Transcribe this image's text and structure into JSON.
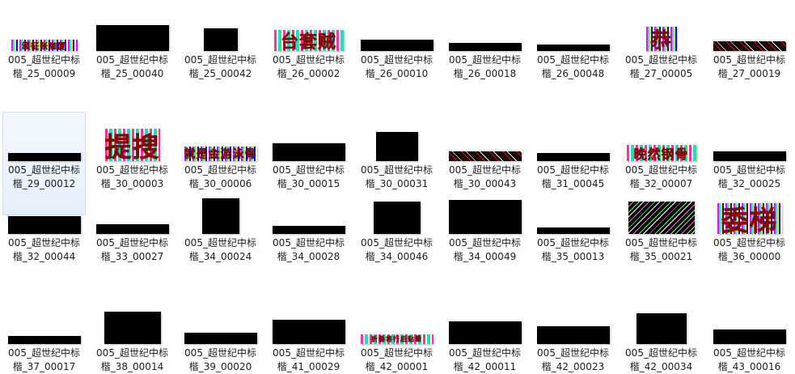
{
  "files": [
    {
      "line1": "005_超世纪中标",
      "line2": "楷_25_00009",
      "thumb": {
        "w": 82,
        "h": 14,
        "style": "stripe-a",
        "glyphs": "颂征张咖厦"
      },
      "selected": false
    },
    {
      "line1": "005_超世纪中标",
      "line2": "楷_25_00040",
      "thumb": {
        "w": 90,
        "h": 32,
        "style": "black"
      },
      "selected": false
    },
    {
      "line1": "005_超世纪中标",
      "line2": "楷_25_00042",
      "thumb": {
        "w": 42,
        "h": 28,
        "style": "black"
      },
      "selected": false
    },
    {
      "line1": "005_超世纪中标",
      "line2": "楷_26_00002",
      "thumb": {
        "w": 86,
        "h": 26,
        "style": "stripe-b",
        "glyphs": "台套贼"
      },
      "selected": false
    },
    {
      "line1": "005_超世纪中标",
      "line2": "楷_26_00010",
      "thumb": {
        "w": 90,
        "h": 14,
        "style": "black"
      },
      "selected": false
    },
    {
      "line1": "005_超世纪中标",
      "line2": "楷_26_00018",
      "thumb": {
        "w": 90,
        "h": 10,
        "style": "black"
      },
      "selected": false
    },
    {
      "line1": "005_超世纪中标",
      "line2": "楷_26_00048",
      "thumb": {
        "w": 90,
        "h": 8,
        "style": "black"
      },
      "selected": false
    },
    {
      "line1": "005_超世纪中标",
      "line2": "楷_27_00005",
      "thumb": {
        "w": 38,
        "h": 30,
        "style": "stripe-a",
        "glyphs": "恭"
      },
      "selected": false
    },
    {
      "line1": "005_超世纪中标",
      "line2": "楷_27_00019",
      "thumb": {
        "w": 90,
        "h": 12,
        "style": "noise"
      },
      "selected": false
    },
    {
      "line1": "005_超世纪中标",
      "line2": "楷_29_00012",
      "thumb": {
        "w": 90,
        "h": 10,
        "style": "black"
      },
      "selected": true
    },
    {
      "line1": "005_超世纪中标",
      "line2": "楷_30_00003",
      "thumb": {
        "w": 68,
        "h": 40,
        "style": "stripe-b",
        "glyphs": "提搜"
      },
      "selected": false
    },
    {
      "line1": "005_超世纪中标",
      "line2": "楷_30_00006",
      "thumb": {
        "w": 90,
        "h": 18,
        "style": "stripe-a",
        "glyphs": "就是金游泳骨"
      },
      "selected": false
    },
    {
      "line1": "005_超世纪中标",
      "line2": "楷_30_00015",
      "thumb": {
        "w": 90,
        "h": 22,
        "style": "black"
      },
      "selected": false
    },
    {
      "line1": "005_超世纪中标",
      "line2": "楷_30_00031",
      "thumb": {
        "w": 52,
        "h": 36,
        "style": "black"
      },
      "selected": false
    },
    {
      "line1": "005_超世纪中标",
      "line2": "楷_30_00043",
      "thumb": {
        "w": 90,
        "h": 12,
        "style": "noise"
      },
      "selected": false
    },
    {
      "line1": "005_超世纪中标",
      "line2": "楷_31_00045",
      "thumb": {
        "w": 90,
        "h": 10,
        "style": "black"
      },
      "selected": false
    },
    {
      "line1": "005_超世纪中标",
      "line2": "楷_32_00007",
      "thumb": {
        "w": 86,
        "h": 20,
        "style": "stripe-b",
        "glyphs": "晚然钢骨"
      },
      "selected": false
    },
    {
      "line1": "005_超世纪中标",
      "line2": "楷_32_00025",
      "thumb": {
        "w": 90,
        "h": 12,
        "style": "black"
      },
      "selected": false
    },
    {
      "line1": "005_超世纪中标",
      "line2": "楷_32_00044",
      "thumb": {
        "w": 90,
        "h": 22,
        "style": "black"
      },
      "selected": false
    },
    {
      "line1": "005_超世纪中标",
      "line2": "楷_33_00027",
      "thumb": {
        "w": 90,
        "h": 12,
        "style": "black"
      },
      "selected": false
    },
    {
      "line1": "005_超世纪中标",
      "line2": "楷_34_00024",
      "thumb": {
        "w": 46,
        "h": 44,
        "style": "black"
      },
      "selected": false
    },
    {
      "line1": "005_超世纪中标",
      "line2": "楷_34_00028",
      "thumb": {
        "w": 90,
        "h": 10,
        "style": "black"
      },
      "selected": false
    },
    {
      "line1": "005_超世纪中标",
      "line2": "楷_34_00046",
      "thumb": {
        "w": 58,
        "h": 40,
        "style": "black"
      },
      "selected": false
    },
    {
      "line1": "005_超世纪中标",
      "line2": "楷_34_00049",
      "thumb": {
        "w": 90,
        "h": 42,
        "style": "black"
      },
      "selected": false
    },
    {
      "line1": "005_超世纪中标",
      "line2": "楷_35_00013",
      "thumb": {
        "w": 90,
        "h": 8,
        "style": "black"
      },
      "selected": false
    },
    {
      "line1": "005_超世纪中标",
      "line2": "楷_35_00021",
      "thumb": {
        "w": 82,
        "h": 40,
        "style": "noise2"
      },
      "selected": false
    },
    {
      "line1": "005_超世纪中标",
      "line2": "楷_36_00000",
      "thumb": {
        "w": 80,
        "h": 38,
        "style": "stripe-a",
        "glyphs": "委梯"
      },
      "selected": false
    },
    {
      "line1": "005_超世纪中标",
      "line2": "楷_37_00017",
      "thumb": {
        "w": 90,
        "h": 10,
        "style": "black"
      },
      "selected": false
    },
    {
      "line1": "005_超世纪中标",
      "line2": "楷_38_00014",
      "thumb": {
        "w": 70,
        "h": 40,
        "style": "black"
      },
      "selected": false
    },
    {
      "line1": "005_超世纪中标",
      "line2": "楷_39_00020",
      "thumb": {
        "w": 90,
        "h": 14,
        "style": "black"
      },
      "selected": false
    },
    {
      "line1": "005_超世纪中标",
      "line2": "楷_41_00029",
      "thumb": {
        "w": 90,
        "h": 30,
        "style": "black"
      },
      "selected": false
    },
    {
      "line1": "005_超世纪中标",
      "line2": "楷_42_00001",
      "thumb": {
        "w": 90,
        "h": 12,
        "style": "stripe-b",
        "glyphs": "折垂将行后贴晕"
      },
      "selected": false
    },
    {
      "line1": "005_超世纪中标",
      "line2": "楷_42_00011",
      "thumb": {
        "w": 90,
        "h": 28,
        "style": "black"
      },
      "selected": false
    },
    {
      "line1": "005_超世纪中标",
      "line2": "楷_42_00023",
      "thumb": {
        "w": 90,
        "h": 22,
        "style": "black"
      },
      "selected": false
    },
    {
      "line1": "005_超世纪中标",
      "line2": "楷_42_00034",
      "thumb": {
        "w": 62,
        "h": 38,
        "style": "black"
      },
      "selected": false
    },
    {
      "line1": "005_超世纪中标",
      "line2": "楷_43_00016",
      "thumb": {
        "w": 90,
        "h": 18,
        "style": "black"
      },
      "selected": false
    }
  ]
}
